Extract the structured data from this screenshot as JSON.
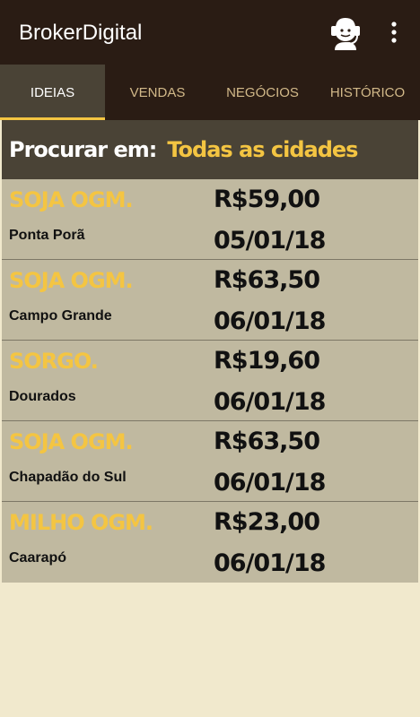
{
  "app": {
    "title": "BrokerDigital"
  },
  "toolbar": {
    "support_icon": "support-agent-icon",
    "menu_icon": "more-vert-icon"
  },
  "tabs": [
    {
      "label": "IDEIAS",
      "active": true
    },
    {
      "label": "VENDAS",
      "active": false
    },
    {
      "label": "NEGÓCIOS",
      "active": false
    },
    {
      "label": "HISTÓRICO",
      "active": false
    }
  ],
  "search": {
    "label": "Procurar em:",
    "value": "Todas as cidades"
  },
  "offers": [
    {
      "product": "SOJA OGM.",
      "city": "Ponta Porã",
      "price": "R$59,00",
      "date": "05/01/18"
    },
    {
      "product": "SOJA OGM.",
      "city": "Campo Grande",
      "price": "R$63,50",
      "date": "06/01/18"
    },
    {
      "product": "SORGO.",
      "city": "Dourados",
      "price": "R$19,60",
      "date": "06/01/18"
    },
    {
      "product": "SOJA OGM.",
      "city": "Chapadão do Sul",
      "price": "R$63,50",
      "date": "06/01/18"
    },
    {
      "product": "MILHO OGM.",
      "city": "Caarapó",
      "price": "R$23,00",
      "date": "06/01/18"
    }
  ],
  "colors": {
    "appbar": "#2a1c14",
    "accent": "#f4c542",
    "tab_active_bg": "#4a4336",
    "list_bg": "#c0b9a0",
    "page_bg": "#f1e9cd"
  }
}
